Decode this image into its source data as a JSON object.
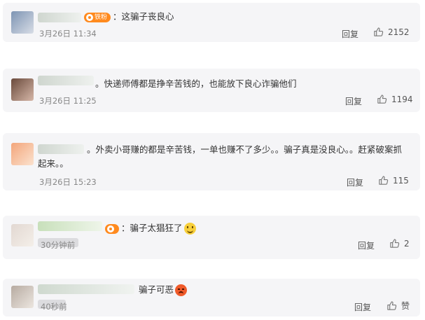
{
  "comments": [
    {
      "badge_label": "铁粉",
      "text": "：这骗子丧良心",
      "time": "3月26日 11:34",
      "reply": "回复",
      "likes": "2152"
    },
    {
      "text": "。快递师傅都是挣辛苦钱的，也能放下良心诈骗他们",
      "time": "3月26日 11:25",
      "reply": "回复",
      "likes": "1194"
    },
    {
      "text": "。外卖小哥赚的都是辛苦钱，一单也赚不了多少。。骗子真是没良心。。赶紧破案抓起来。。",
      "time": "3月26日 15:23",
      "reply": "回复",
      "likes": "115"
    },
    {
      "text": "：骗子太猖狂了",
      "time": "30分钟前",
      "reply": "回复",
      "likes": "2"
    },
    {
      "text": "骗子可恶",
      "time": "40秒前",
      "reply": "回复",
      "likes": "赞"
    }
  ],
  "icons": {
    "like": "thumbs-up-icon",
    "badge": "fan-badge-icon",
    "emoji_smile": "smile-emoji-icon",
    "emoji_angry": "angry-emoji-icon"
  },
  "colors": {
    "badge": "#ff8a1e",
    "card_bg": "#f5f5f7",
    "text": "#333333",
    "meta": "#888888"
  }
}
